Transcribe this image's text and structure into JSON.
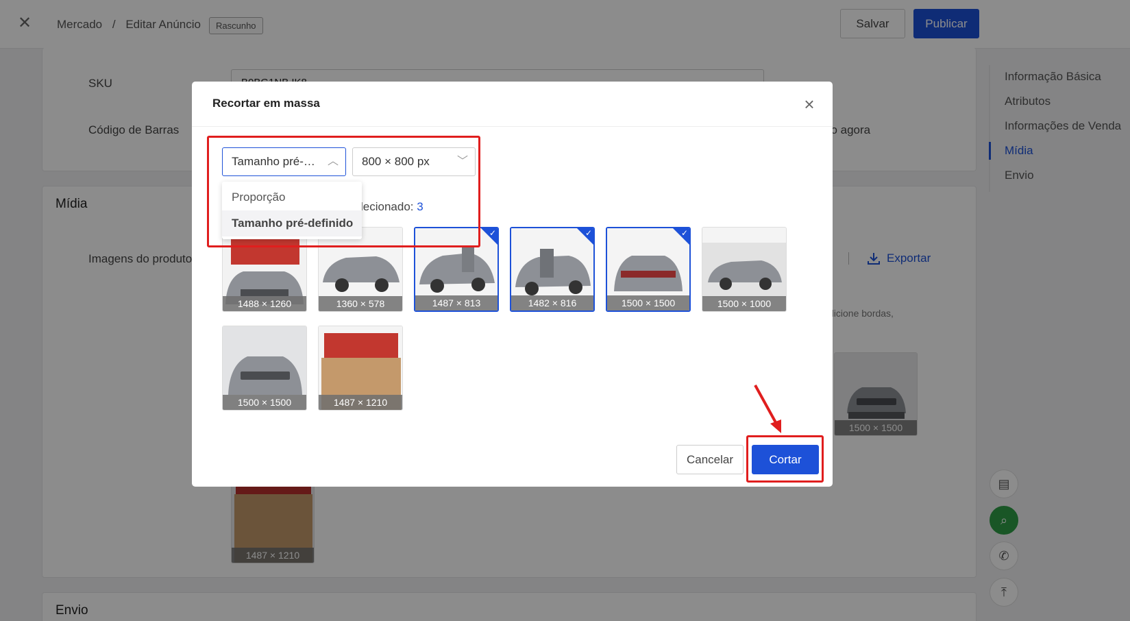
{
  "header": {
    "breadcrumb": [
      "Mercado",
      "/",
      "Editar Anúncio"
    ],
    "badge": "Rascunho",
    "save_label": "Salvar",
    "publish_label": "Publicar"
  },
  "basic": {
    "sku_label": "SKU",
    "sku_value": "B0BG1NB.IK8",
    "barcode_label": "Código de Barras",
    "barcode_tail": "ho agora"
  },
  "media": {
    "title": "Mídia",
    "images_label": "Imagens do produto",
    "export_label": "Exportar",
    "hint": "dicione bordas,",
    "bg_thumbs": [
      {
        "dim": "1500 × 1500"
      },
      {
        "dim": "1487 × 1210"
      }
    ]
  },
  "shipping": {
    "title": "Envio"
  },
  "side_nav": {
    "items": [
      "Informação Básica",
      "Atributos",
      "Informações de Venda",
      "Mídia",
      "Envio"
    ],
    "active": "Mídia"
  },
  "modal": {
    "title": "Recortar em massa",
    "mode_select": "Tamanho pré-definido",
    "size_select": "800 × 800 px",
    "dropdown": [
      "Proporção",
      "Tamanho pré-definido"
    ],
    "selected_prefix": "lecionado:",
    "selected_count": "3",
    "images": [
      {
        "dim": "1488 × 1260",
        "checked": false
      },
      {
        "dim": "1360 × 578",
        "checked": false
      },
      {
        "dim": "1487 × 813",
        "checked": true
      },
      {
        "dim": "1482 × 816",
        "checked": true
      },
      {
        "dim": "1500 × 1500",
        "checked": true
      },
      {
        "dim": "1500 × 1000",
        "checked": false
      },
      {
        "dim": "1500 × 1500",
        "checked": false
      },
      {
        "dim": "1487 × 1210",
        "checked": false
      }
    ],
    "cancel_label": "Cancelar",
    "cut_label": "Cortar"
  },
  "colors": {
    "primary": "#1d51d8",
    "annotation": "#e01e1e"
  }
}
